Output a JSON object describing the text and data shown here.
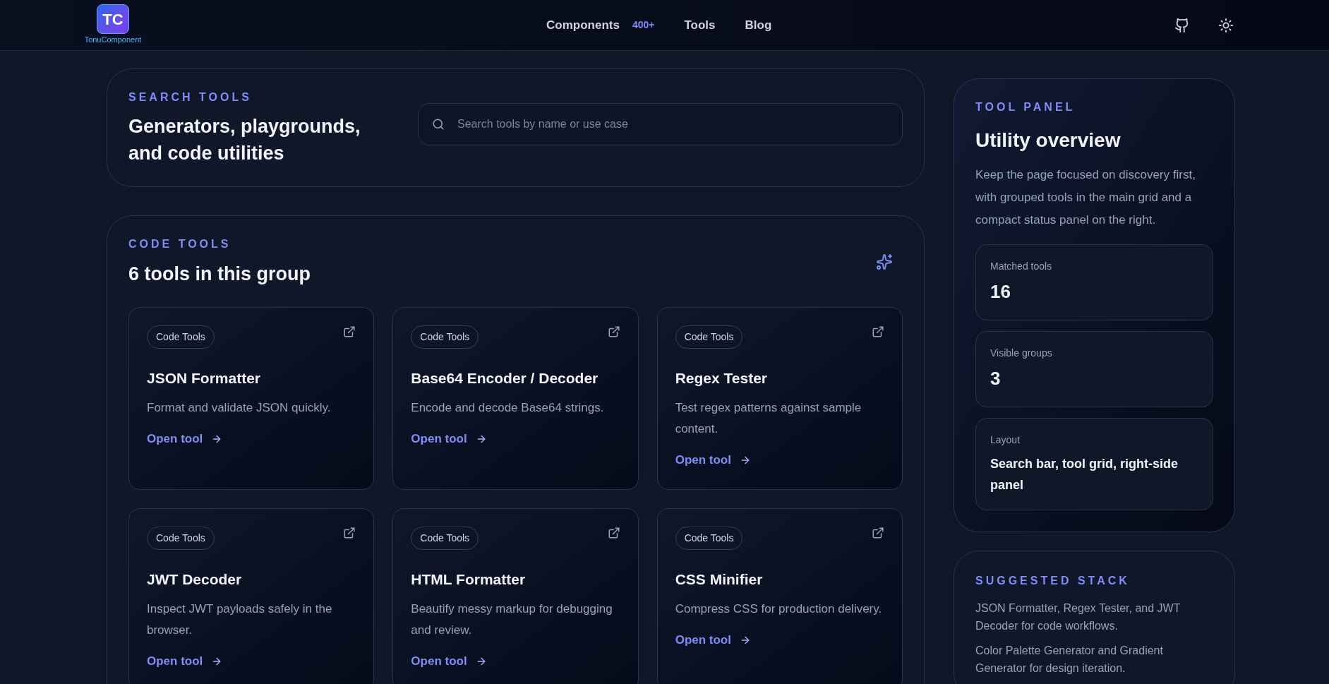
{
  "header": {
    "logo": {
      "mark": "TC",
      "name": "TonuComponent"
    },
    "nav": [
      {
        "label": "Components",
        "badge": "400+"
      },
      {
        "label": "Tools"
      },
      {
        "label": "Blog"
      }
    ]
  },
  "search_card": {
    "eyebrow": "SEARCH TOOLS",
    "title": "Generators, playgrounds, and code utilities",
    "placeholder": "Search tools by name or use case"
  },
  "group": {
    "eyebrow": "CODE TOOLS",
    "title": "6 tools in this group",
    "tools": [
      {
        "tag": "Code Tools",
        "name": "JSON Formatter",
        "description": "Format and validate JSON quickly.",
        "link": "Open tool"
      },
      {
        "tag": "Code Tools",
        "name": "Base64 Encoder / Decoder",
        "description": "Encode and decode Base64 strings.",
        "link": "Open tool"
      },
      {
        "tag": "Code Tools",
        "name": "Regex Tester",
        "description": "Test regex patterns against sample content.",
        "link": "Open tool"
      },
      {
        "tag": "Code Tools",
        "name": "JWT Decoder",
        "description": "Inspect JWT payloads safely in the browser.",
        "link": "Open tool"
      },
      {
        "tag": "Code Tools",
        "name": "HTML Formatter",
        "description": "Beautify messy markup for debugging and review.",
        "link": "Open tool"
      },
      {
        "tag": "Code Tools",
        "name": "CSS Minifier",
        "description": "Compress CSS for production delivery.",
        "link": "Open tool"
      }
    ]
  },
  "panel": {
    "eyebrow": "TOOL PANEL",
    "title": "Utility overview",
    "description": "Keep the page focused on discovery first, with grouped tools in the main grid and a compact status panel on the right.",
    "stats": [
      {
        "kind": "number",
        "label": "Matched tools",
        "value": "16"
      },
      {
        "kind": "number",
        "label": "Visible groups",
        "value": "3"
      },
      {
        "kind": "text",
        "label": "Layout",
        "value": "Search bar, tool grid, right-side panel"
      }
    ]
  },
  "suggested": {
    "eyebrow": "SUGGESTED STACK",
    "items": [
      "JSON Formatter, Regex Tester, and JWT Decoder for code workflows.",
      "Color Palette Generator and Gradient Generator for design iteration."
    ]
  }
}
